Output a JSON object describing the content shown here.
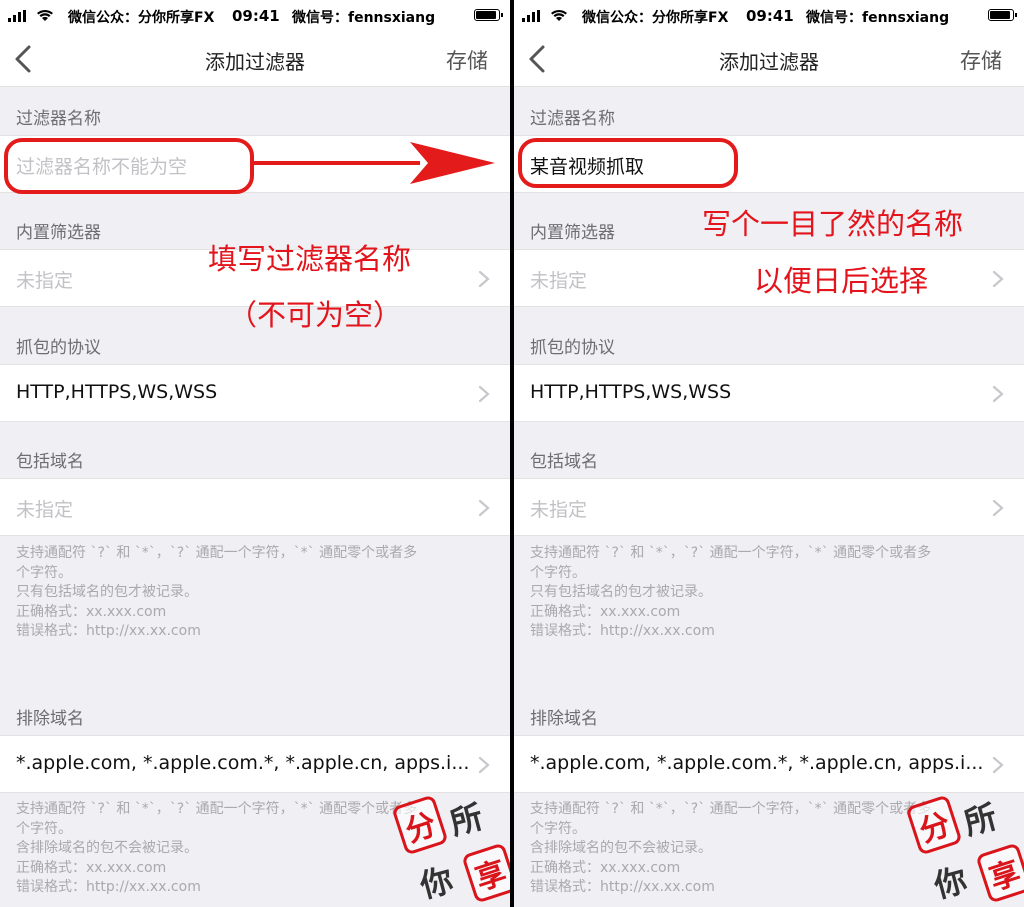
{
  "status_bar": {
    "wechat_account": "微信公众：分你所享FX",
    "time": "09:41",
    "wechat_id": "微信号：fennsxiang"
  },
  "nav": {
    "title": "添加过滤器",
    "save_label": "存储",
    "back_icon": "chevron-left-icon"
  },
  "form": {
    "name_section": "过滤器名称",
    "builtin_section": "内置筛选器",
    "protocol_section": "抓包的协议",
    "include_section": "包括域名",
    "exclude_section": "排除域名",
    "unspecified": "未指定",
    "protocol_value": "HTTP,HTTPS,WS,WSS",
    "exclude_value": "*.apple.com, *.apple.com.*, *.apple.cn, apps.i...",
    "include_note": [
      "支持通配符 `?` 和 `*`，`?` 通配一个字符，`*` 通配零个或者多",
      "个字符。",
      "只有包括域名的包才被记录。",
      "正确格式：xx.xxx.com",
      "错误格式：http://xx.xx.com"
    ],
    "exclude_note": [
      "支持通配符 `?` 和 `*`，`?` 通配一个字符，`*` 通配零个或者多",
      "个字符。",
      "含排除域名的包不会被记录。",
      "正确格式：xx.xxx.com",
      "错误格式：http://xx.xx.com"
    ]
  },
  "left": {
    "name_placeholder": "过滤器名称不能为空"
  },
  "right": {
    "name_value": "某音视频抓取"
  },
  "annotations": {
    "left_line1": "填写过滤器名称",
    "left_line2": "（不可为空）",
    "right_line1": "写个一目了然的名称",
    "right_line2": "以便日后选择",
    "color": "#e3141b"
  },
  "watermark": {
    "chars": [
      "分",
      "所",
      "你",
      "享"
    ],
    "color": "#d9141a"
  }
}
